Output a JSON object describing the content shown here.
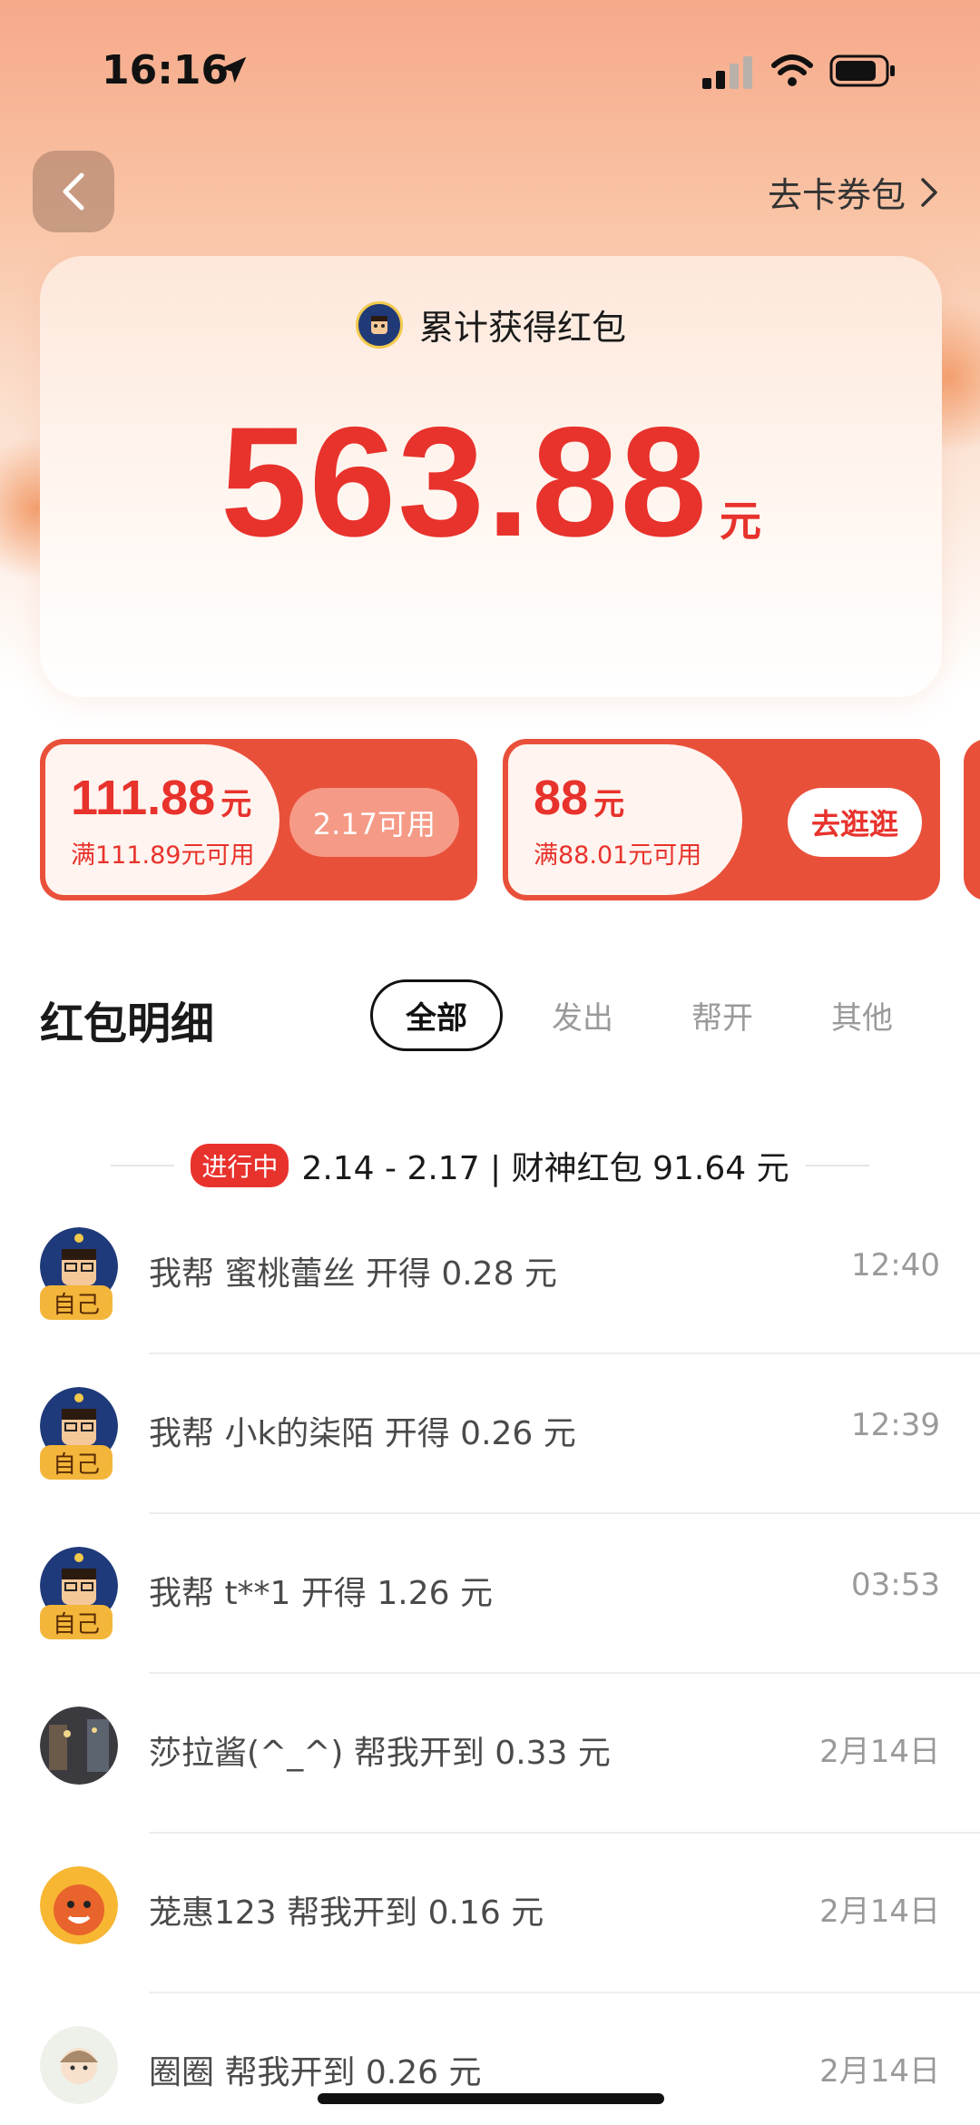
{
  "status_bar": {
    "time": "16:16"
  },
  "nav": {
    "coupon_link": "去卡券包"
  },
  "total_card": {
    "title": "累计获得红包",
    "amount": "563.88",
    "unit": "元"
  },
  "coupons": [
    {
      "value": "111.88",
      "unit": "元",
      "condition": "满111.89元可用",
      "button": "2.17可用",
      "state": "disabled"
    },
    {
      "value": "88",
      "unit": "元",
      "condition": "满88.01元可用",
      "button": "去逛逛",
      "state": "active"
    }
  ],
  "detail": {
    "title": "红包明细",
    "tabs": [
      "全部",
      "发出",
      "帮开",
      "其他"
    ],
    "active_tab": "全部"
  },
  "period": {
    "badge": "进行中",
    "text": "2.14 - 2.17 | 财神红包  91.64 元"
  },
  "records": [
    {
      "text": "我帮  蜜桃蕾丝  开得 0.28 元",
      "time": "12:40",
      "self_badge": "自己",
      "avatar": "self-avatar"
    },
    {
      "text": "我帮  小k的柒陌  开得 0.26 元",
      "time": "12:39",
      "self_badge": "自己",
      "avatar": "self-avatar"
    },
    {
      "text": "我帮  t**1  开得 1.26 元",
      "time": "03:53",
      "self_badge": "自己",
      "avatar": "self-avatar"
    },
    {
      "text": "莎拉酱(^_^) 帮我开到 0.33 元",
      "time": "2月14日",
      "self_badge": "",
      "avatar": "photo-avatar"
    },
    {
      "text": "茏惠123 帮我开到 0.16 元",
      "time": "2月14日",
      "self_badge": "",
      "avatar": "cartoon-avatar"
    },
    {
      "text": "圈圈 帮我开到 0.26 元",
      "time": "2月14日",
      "self_badge": "",
      "avatar": "illustrated-avatar"
    }
  ],
  "colors": {
    "accent_red": "#e8322c",
    "coupon_red": "#e9503a",
    "badge_gold": "#f4b63a"
  }
}
